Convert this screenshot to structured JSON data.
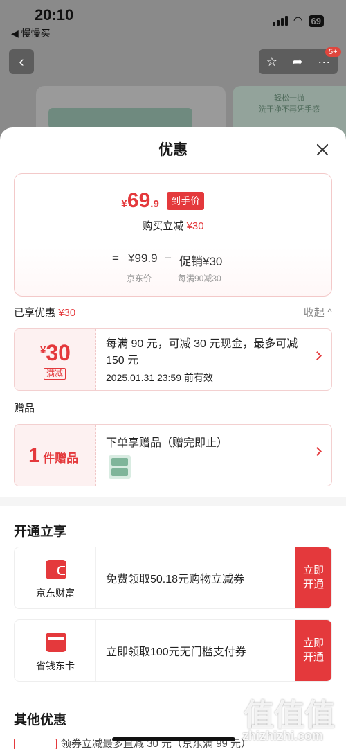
{
  "status_bar": {
    "time": "20:10",
    "back_app": "◀ 慢慢买",
    "battery": "69"
  },
  "background": {
    "promo_line1": "轻松一抛",
    "promo_line2": "洗干净不再凭手感",
    "badge": "5+"
  },
  "sheet": {
    "title": "优惠"
  },
  "price": {
    "yen": "¥",
    "final_int": "69",
    "final_dec": ".9",
    "final_tag": "到手价",
    "buy_label": "购买立减",
    "buy_amount": "¥30",
    "formula": {
      "eq": "=",
      "jd_price": "¥99.9",
      "minus": "−",
      "promo": "促销¥30",
      "jd_price_label": "京东价",
      "promo_label": "每满90减30"
    }
  },
  "enjoyed": {
    "label": "已享优惠",
    "amount": "¥30",
    "collapse": "收起 ^"
  },
  "coupon": {
    "yen": "¥",
    "amount": "30",
    "type": "满减",
    "desc": "每满 90 元，可减 30 元现金，最多可减 150 元",
    "valid": "2025.01.31 23:59 前有效"
  },
  "gift": {
    "section": "赠品",
    "count": "1",
    "unit": "件赠品",
    "title": "下单享赠品（赠完即止）"
  },
  "open_section": {
    "title": "开通立享",
    "cards": [
      {
        "label": "京东财富",
        "desc": "免费领取50.18元购物立减券",
        "button": "立即开通",
        "icon": "wallet-icon"
      },
      {
        "label": "省钱东卡",
        "desc": "立即领取100元无门槛支付券",
        "button": "立即开通",
        "icon": "card-icon"
      }
    ]
  },
  "other": {
    "title": "其他优惠",
    "peek_text": "领券立减最多直减 30 元（京东满 99 元）"
  },
  "watermark": {
    "logo": "值值值",
    "site": "zhizhizhi.com"
  },
  "colors": {
    "accent": "#e4393c",
    "coupon_bg": "#fdf1f1"
  }
}
